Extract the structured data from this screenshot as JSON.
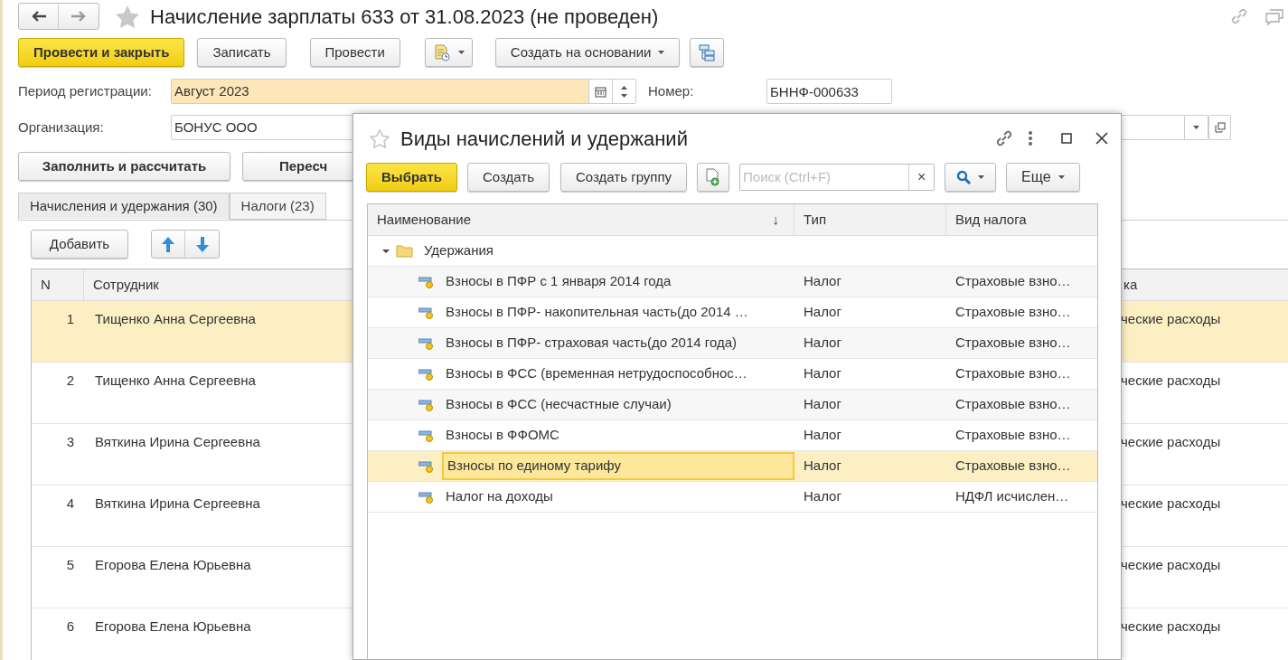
{
  "document": {
    "title": "Начисление зарплаты 633 от 31.08.2023 (не проведен)",
    "toolbar": [
      {
        "label": "Провести и закрыть",
        "kind": "primary"
      },
      {
        "label": "Записать",
        "kind": "plain"
      },
      {
        "label": "Провести",
        "kind": "plain"
      },
      {
        "kind": "report"
      },
      {
        "label": "Создать на основании",
        "kind": "dropdown"
      },
      {
        "kind": "structure"
      }
    ],
    "period": {
      "label": "Период регистрации:",
      "value": "Август 2023"
    },
    "number": {
      "label": "Номер:",
      "value": "БННФ-000633"
    },
    "organization": {
      "label": "Организация:",
      "value": "БОНУС ООО"
    },
    "actions": [
      "Заполнить и рассчитать",
      "Пересч"
    ],
    "tabs": [
      {
        "label": "Начисления и удержания (30)",
        "selected": true
      },
      {
        "label": "Налоги (23)",
        "selected": false
      }
    ],
    "add_button": "Добавить",
    "table": {
      "columns": [
        "N",
        "Сотрудник",
        "ка"
      ],
      "rows": [
        {
          "n": "1",
          "employee": "Тищенко Анна Сергеевна",
          "column_3": "ческие расходы",
          "selected": true
        },
        {
          "n": "2",
          "employee": "Тищенко Анна Сергеевна",
          "column_3": "ческие расходы",
          "selected": false
        },
        {
          "n": "3",
          "employee": "Вяткина Ирина Сергеевна",
          "column_3": "ческие расходы",
          "selected": false
        },
        {
          "n": "4",
          "employee": "Вяткина Ирина Сергеевна",
          "column_3": "ческие расходы",
          "selected": false
        },
        {
          "n": "5",
          "employee": "Егорова Елена Юрьевна",
          "column_3": "ческие расходы",
          "selected": false
        },
        {
          "n": "6",
          "employee": "Егорова Елена Юрьевна",
          "column_3": "ческие расходы",
          "selected": false
        }
      ]
    }
  },
  "dialog": {
    "title": "Виды начислений и удержаний",
    "toolbar": [
      {
        "label": "Выбрать",
        "kind": "primary"
      },
      {
        "label": "Создать",
        "kind": "plain"
      },
      {
        "label": "Создать группу",
        "kind": "plain"
      },
      {
        "kind": "add"
      }
    ],
    "search": {
      "placeholder": "Поиск (Ctrl+F)",
      "clear": "×"
    },
    "more": "Еще",
    "table": {
      "columns": [
        {
          "label": "Наименование",
          "sort": "↓"
        },
        {
          "label": "Тип"
        },
        {
          "label": "Вид налога"
        }
      ],
      "group": {
        "name": "Удержания",
        "expanded": true,
        "children": [
          {
            "name": "Взносы в ПФР  с 1 января 2014 года",
            "type": "Налог",
            "tax": "Страховые взно…",
            "selected": false
          },
          {
            "name": "Взносы в ПФР- накопительная часть(до 2014 …",
            "type": "Налог",
            "tax": "Страховые взно…",
            "selected": false
          },
          {
            "name": "Взносы в ПФР- страховая часть(до 2014 года)",
            "type": "Налог",
            "tax": "Страховые взно…",
            "selected": false
          },
          {
            "name": "Взносы в ФСС (временная нетрудоспособнос…",
            "type": "Налог",
            "tax": "Страховые взно…",
            "selected": false
          },
          {
            "name": "Взносы в ФСС (несчастные случаи)",
            "type": "Налог",
            "tax": "Страховые взно…",
            "selected": false
          },
          {
            "name": "Взносы в ФФОМС",
            "type": "Налог",
            "tax": "Страховые взно…",
            "selected": false
          },
          {
            "name": "Взносы по единому тарифу",
            "type": "Налог",
            "tax": "Страховые взно…",
            "selected": true
          },
          {
            "name": "Налог на доходы",
            "type": "Налог",
            "tax": "НДФЛ исчислен…",
            "selected": false
          }
        ]
      }
    }
  }
}
